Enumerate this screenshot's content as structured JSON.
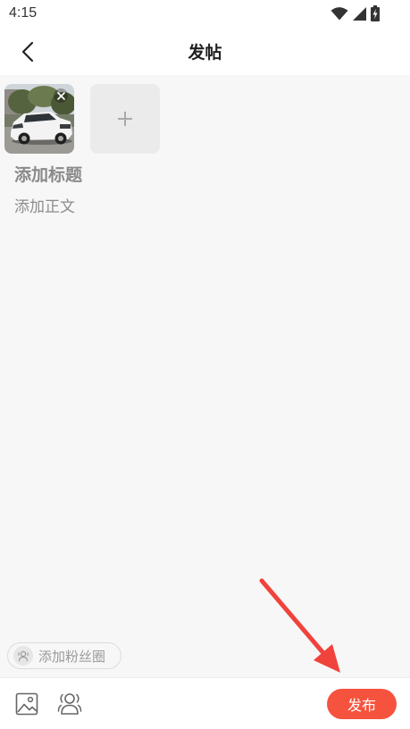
{
  "status_bar": {
    "time": "4:15",
    "icons": [
      "wifi-icon",
      "signal-icon",
      "battery-icon"
    ]
  },
  "header": {
    "title": "发帖",
    "back_icon": "chevron-left-icon"
  },
  "media": {
    "attachments": [
      {
        "remove_icon": "close-icon"
      }
    ],
    "add_icon": "plus-icon"
  },
  "post": {
    "title_placeholder": "添加标题",
    "body_placeholder": "添加正文"
  },
  "fan_circle": {
    "label": "添加粉丝圈",
    "icon": "fan-circle-icon"
  },
  "toolbar": {
    "image_icon": "image-icon",
    "group_icon": "group-icon",
    "publish_label": "发布"
  },
  "colors": {
    "accent": "#f5533d",
    "page_background": "#f7f7f7",
    "placeholder_text": "#8c8c8c",
    "annotation": "#f0433c"
  }
}
